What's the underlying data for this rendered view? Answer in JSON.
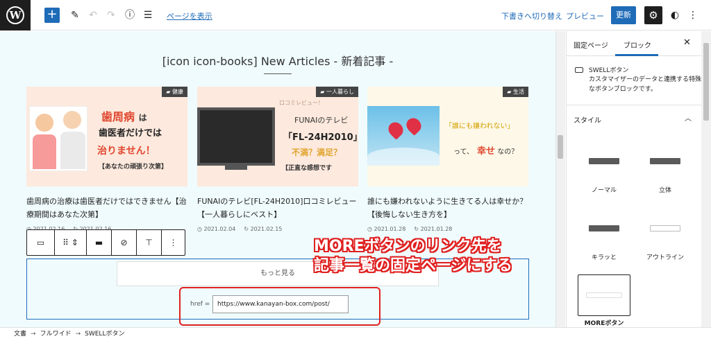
{
  "toolbar": {
    "add_icon": "+",
    "view_page_label": "ページを表示",
    "switch_draft_label": "下書きへ切り替え",
    "preview_label": "プレビュー",
    "update_label": "更新"
  },
  "editor": {
    "heading": "[icon icon-books] New Articles - 新着記事 -",
    "cards": [
      {
        "category": "健康",
        "thumb_lines": [
          "歯周病",
          "は",
          "歯医者だけでは",
          "治りません！",
          "【あなたの頑張り次第】"
        ],
        "title": "歯周病の治療は歯医者だけではできません【治療期間はあなた次第】",
        "published": "2021.02.16",
        "updated": "2021.02.16"
      },
      {
        "category": "一人暮らし",
        "thumb_lines": [
          "口コミレビュー！",
          "FUNAIのテレビ",
          "「FL-24H2010」",
          "不満？満足？",
          "【正直な感想です"
        ],
        "title": "FUNAIのテレビ[FL-24H2010]口コミレビュー【一人暮らしにベスト】",
        "published": "2021.02.04",
        "updated": "2021.02.15"
      },
      {
        "category": "生活",
        "thumb_lines": [
          "「誰にも嫌われない」",
          "って、",
          "幸せ",
          "なの？"
        ],
        "title": "誰にも嫌われないように生きてる人は幸せか？【後悔しない生き方を】",
        "published": "2021.01.28",
        "updated": "2021.01.28"
      }
    ],
    "more_button_label": "もっと見る",
    "href_label": "href =",
    "href_value": "https://www.kanayan-box.com/post/",
    "annotation_lines": [
      "MOREボタンのリンク先を",
      "記事一覧の固定ページにする"
    ]
  },
  "sidebar": {
    "tabs": [
      "固定ページ",
      "ブロック"
    ],
    "active_tab": "ブロック",
    "block_title": "SWELLボタン",
    "block_description": "カスタマイザーのデータと連携する特殊なボタンブロックです。",
    "styles_section": "スタイル",
    "style_options": [
      {
        "label": "ノーマル",
        "selected": false
      },
      {
        "label": "立体",
        "selected": false
      },
      {
        "label": "キラッと",
        "selected": false
      },
      {
        "label": "アウトライン",
        "selected": false
      },
      {
        "label": "MOREボタン",
        "selected": true
      }
    ]
  },
  "breadcrumb": [
    "文書",
    "フルワイド",
    "SWELLボタン"
  ],
  "colors": {
    "accent": "#1e6bb8",
    "annotation_red": "#e02020",
    "canvas_bg": "#f0fbfd"
  }
}
